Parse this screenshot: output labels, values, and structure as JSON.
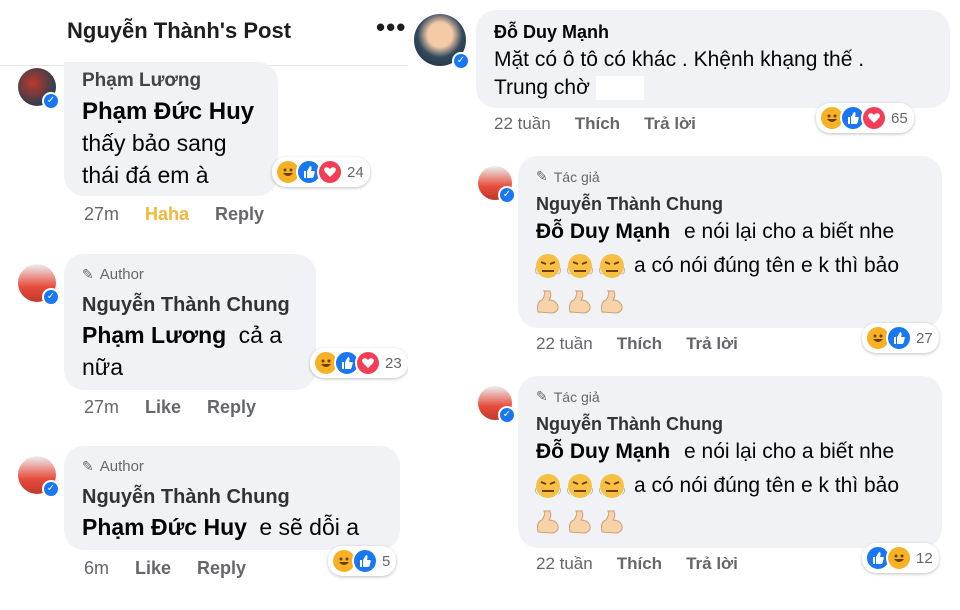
{
  "left": {
    "post_title": "Nguyễn Thành's Post",
    "more_label": "•••",
    "comments": [
      {
        "author": "Phạm Lương",
        "mention": "Phạm Đức Huy",
        "text_line1": "thấy bảo sang",
        "text_line2": "thái đá em à",
        "time": "27m",
        "reaction_label": "Haha",
        "reply_label": "Reply",
        "reaction_count": "24"
      },
      {
        "author_tag": "Author",
        "author": "Nguyễn Thành Chung",
        "mention": "Phạm Lương",
        "text_line1": "cả a",
        "text_line2": "nữa",
        "time": "27m",
        "like_label": "Like",
        "reply_label": "Reply",
        "reaction_count": "23"
      },
      {
        "author_tag": "Author",
        "author": "Nguyễn Thành Chung",
        "mention": "Phạm Đức Huy",
        "text_line1": "e sẽ dỗi a",
        "time": "6m",
        "like_label": "Like",
        "reply_label": "Reply",
        "reaction_count": "5"
      }
    ]
  },
  "right": {
    "comments": [
      {
        "author": "Đỗ Duy Mạnh",
        "text_line1": "Mặt có ô tô có khác . Khệnh khạng thế .",
        "text_line2": "Trung chờ",
        "time": "22 tuần",
        "like_label": "Thích",
        "reply_label": "Trả lời",
        "reaction_count": "65"
      },
      {
        "author_tag": "Tác giả",
        "author": "Nguyễn Thành Chung",
        "mention": "Đỗ Duy Mạnh",
        "text_line1": "e nói lại cho a biết nhe",
        "text_line2": "a có nói đúng tên e k thì bảo",
        "time": "22 tuần",
        "like_label": "Thích",
        "reply_label": "Trả lời",
        "reaction_count": "27"
      },
      {
        "author_tag": "Tác giả",
        "author": "Nguyễn Thành Chung",
        "mention": "Đỗ Duy Mạnh",
        "text_line1": "e nói lại cho a biết nhe",
        "text_line2": "a có nói đúng tên e k thì bảo",
        "time": "22 tuần",
        "like_label": "Thích",
        "reply_label": "Trả lời",
        "reaction_count": "12"
      }
    ]
  },
  "colors": {
    "bubble": "#f0f2f5",
    "meta": "#65676b",
    "haha_active": "#f0b93b",
    "like_blue": "#1877f2",
    "love_red": "#f33e58",
    "haha_yellow": "#f7b125"
  }
}
